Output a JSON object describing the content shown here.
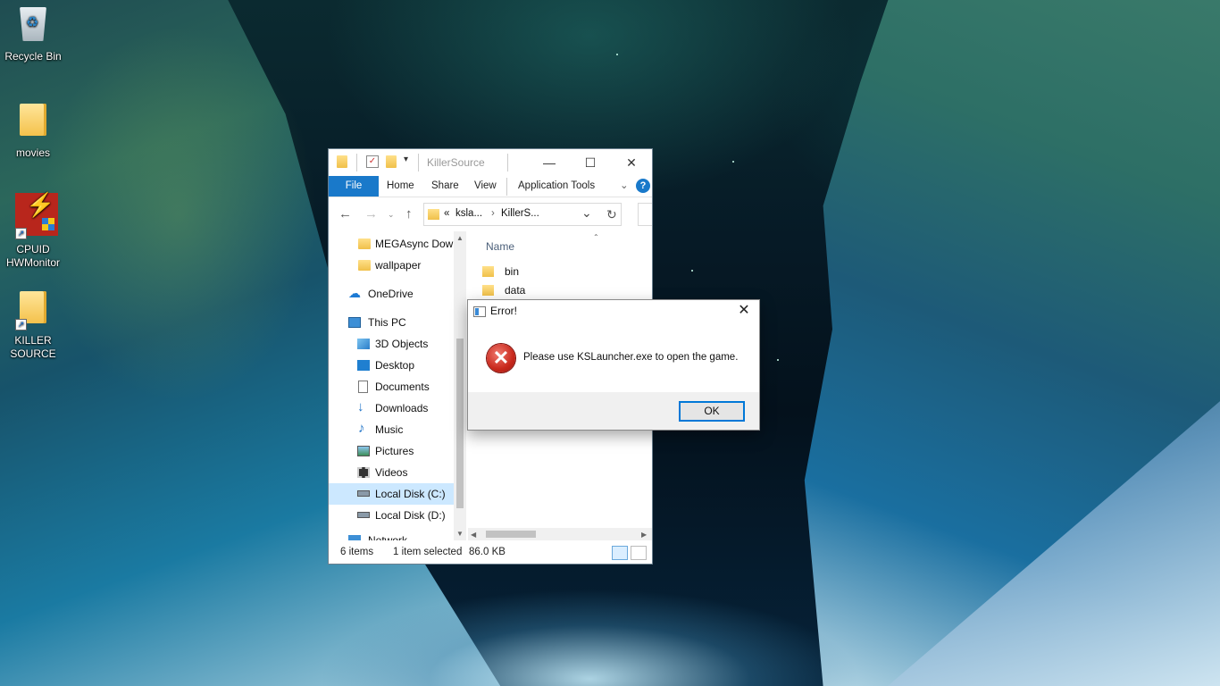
{
  "desktop": {
    "icons": [
      {
        "label": "Recycle Bin",
        "icon": "recycle-bin-icon"
      },
      {
        "label": "movies",
        "icon": "folder-icon"
      },
      {
        "label": "CPUID HWMonitor",
        "line1": "CPUID",
        "line2": "HWMonitor",
        "icon": "hwmonitor-icon"
      },
      {
        "label": "KILLER SOURCE",
        "line1": "KILLER",
        "line2": "SOURCE",
        "icon": "folder-shortcut-icon"
      }
    ]
  },
  "explorer": {
    "title": "KillerSource",
    "window_controls": {
      "minimize": "—",
      "maximize": "☐",
      "close": "✕"
    },
    "ribbon_tabs": [
      "File",
      "Home",
      "Share",
      "View",
      "Application Tools"
    ],
    "help": "?",
    "nav_buttons": {
      "back": "←",
      "forward": "→",
      "up": "↑",
      "refresh": "↻"
    },
    "address": {
      "overflow": "«",
      "crumb1": "ksla...",
      "sep": "›",
      "crumb2": "KillerS...",
      "dropdown": "⌄"
    },
    "nav_pane": [
      {
        "label": "MEGAsync Dow",
        "icon": "folder-icon"
      },
      {
        "label": "wallpaper",
        "icon": "folder-icon"
      },
      {
        "label": "OneDrive",
        "icon": "onedrive-icon"
      },
      {
        "label": "This PC",
        "icon": "computer-icon"
      },
      {
        "label": "3D Objects",
        "icon": "cube-icon"
      },
      {
        "label": "Desktop",
        "icon": "desktop-icon"
      },
      {
        "label": "Documents",
        "icon": "document-icon"
      },
      {
        "label": "Downloads",
        "icon": "download-icon"
      },
      {
        "label": "Music",
        "icon": "music-icon"
      },
      {
        "label": "Pictures",
        "icon": "pictures-icon"
      },
      {
        "label": "Videos",
        "icon": "video-icon"
      },
      {
        "label": "Local Disk (C:)",
        "icon": "drive-icon",
        "selected": true
      },
      {
        "label": "Local Disk (D:)",
        "icon": "drive-icon"
      },
      {
        "label": "Network",
        "icon": "network-icon"
      }
    ],
    "column_header": "Name",
    "files": [
      {
        "name": "bin"
      },
      {
        "name": "data"
      }
    ],
    "status": {
      "items": "6 items",
      "selected": "1 item selected",
      "size": "86.0 KB"
    }
  },
  "dialog": {
    "title": "Error!",
    "close": "✕",
    "icon_glyph": "✕",
    "message": "Please use KSLauncher.exe to open the game.",
    "ok_label": "OK"
  },
  "colors": {
    "accent": "#1979ca",
    "selection": "#cce8ff",
    "error_red": "#c8281c"
  }
}
